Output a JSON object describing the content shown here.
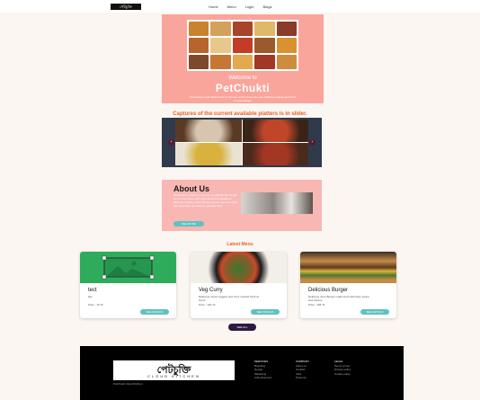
{
  "nav": {
    "logo": "পেটচুক্তি",
    "links": [
      "Home",
      "Menu",
      "Login",
      "Blogs"
    ]
  },
  "hero": {
    "welcome": "Welcome to",
    "title": "PetChukti",
    "subtitle": "We Deliver Food Made fresh by Women of the house who are skilled at making authentic homely dishes"
  },
  "captures": "Captures of the current available platters is in slider.",
  "slider": {
    "prev": "‹",
    "next": "›"
  },
  "about": {
    "heading": "About Us",
    "paragraph": "PetChukti is made on purpose to entertain the hunger of our food lovers with good amount of platters in delicious healthy meal. We are not just one cook here but many from our home to prepare food.",
    "button": "SEE MORE"
  },
  "latest": "Latest Menu",
  "cards": [
    {
      "title": "tect",
      "desc": "abc",
      "price": "Price : 10 Tk",
      "button": "SEE DETAILS"
    },
    {
      "title": "Veg Curry",
      "desc": "Delicious mixed veggies and curry cooked fresh at home",
      "price": "Price : 120 Tk",
      "button": "SEE DETAILS"
    },
    {
      "title": "Delicious Burger",
      "desc": "Delicious Juicy Burger made fresh with tasty sauce and cheese",
      "price": "Price : 165 Tk",
      "button": "SEE DETAILS"
    }
  ],
  "see_all": "SEE ALL",
  "footer": {
    "logo_main": "পেটচুক্তি",
    "logo_sub": "CLOUD KITCHEN",
    "tag": "PetChukti Cloud Kitchen",
    "col1": {
      "head": "SERVICES",
      "items": [
        "Branding",
        "Design",
        "Marketing",
        "Advertisement"
      ]
    },
    "col2": {
      "head": "COMPANY",
      "items": [
        "About us",
        "Contact",
        "Jobs",
        "Press kit"
      ]
    },
    "col3": {
      "head": "LEGAL",
      "items": [
        "Terms of use",
        "Privacy policy",
        "Cookie policy"
      ]
    }
  }
}
